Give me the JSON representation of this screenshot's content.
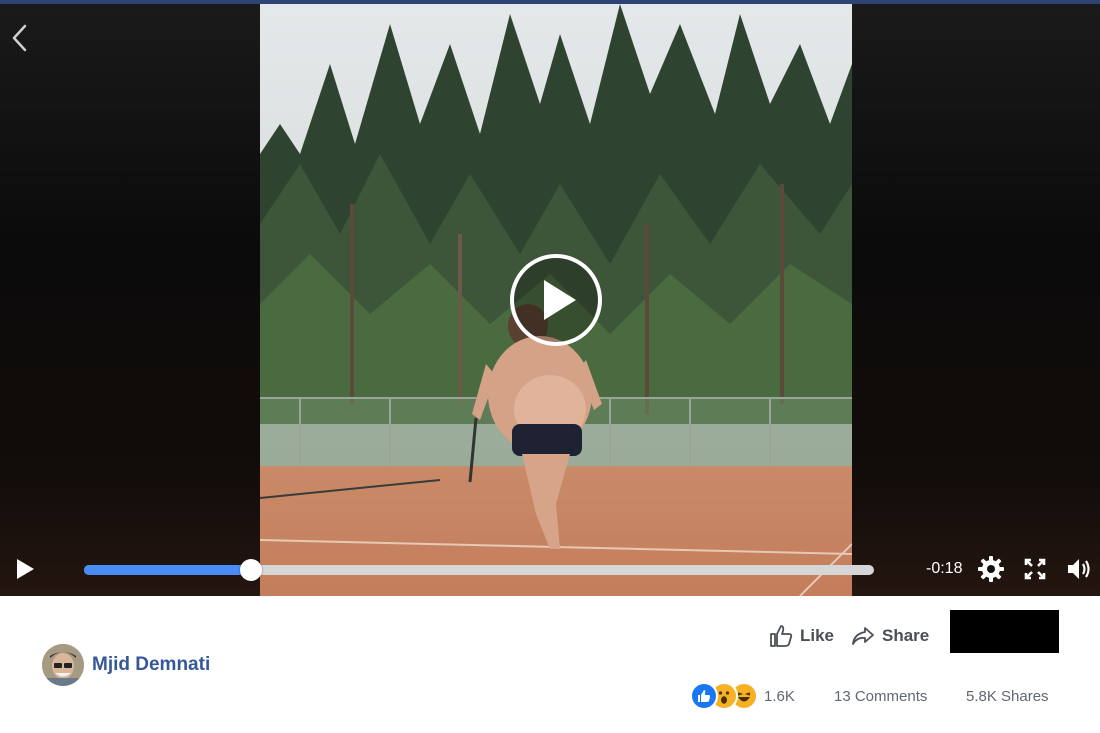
{
  "video": {
    "remaining_time": "-0:18",
    "progress": 0.212,
    "colors": {
      "progress_fill": "#4a8cf6",
      "progress_track": "#d6d6d6"
    }
  },
  "icons": {
    "back": "chevron-left-icon",
    "center_play": "play-circle-icon",
    "play": "play-icon",
    "settings": "gear-icon",
    "fullscreen": "fullscreen-icon",
    "volume": "speaker-icon",
    "like": "thumbs-up-icon",
    "share": "share-arrow-icon"
  },
  "post": {
    "author": "Mjid Demnati",
    "like_label": "Like",
    "share_label": "Share",
    "reaction_count": "1.6K",
    "comments": "13 Comments",
    "shares": "5.8K Shares",
    "colors": {
      "author": "#365899",
      "accent": "#2d4373"
    }
  }
}
